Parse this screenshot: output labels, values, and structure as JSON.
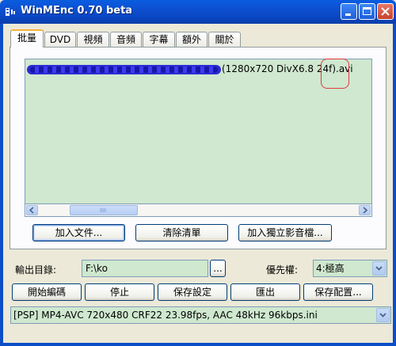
{
  "window": {
    "title": "WinMEnc 0.70 beta"
  },
  "tabs": [
    {
      "label": "批量"
    },
    {
      "label": "DVD"
    },
    {
      "label": "視頻"
    },
    {
      "label": "音頻"
    },
    {
      "label": "字幕"
    },
    {
      "label": "額外"
    },
    {
      "label": "關於"
    }
  ],
  "file_list": {
    "items": [
      {
        "visible_suffix": "(1280x720 DivX6.8 24f).avi"
      }
    ]
  },
  "batch_buttons": {
    "add_file": "加入文件...",
    "clear_list": "清除清單",
    "add_audio": "加入獨立影音檔..."
  },
  "output": {
    "label": "輸出目錄:",
    "value": "F:\\ko",
    "browse_label": "..."
  },
  "priority": {
    "label": "優先權:",
    "selected": "4:極高"
  },
  "actions": {
    "start": "開始編碼",
    "stop": "停止",
    "save_settings": "保存設定",
    "export": "匯出",
    "save_profile": "保存配置..."
  },
  "profile": {
    "selected": "[PSP] MP4-AVC 720x480 CRF22 23.98fps, AAC 48kHz 96kbps.ini"
  },
  "colors": {
    "titlebar": "#0a5de0",
    "field_bg": "#cfe8cf",
    "dialog_bg": "#ece9d8",
    "annotation": "#e0393e"
  },
  "icons": {
    "app": "app-icon",
    "minimize": "minimize-icon",
    "maximize": "maximize-icon",
    "close": "close-icon",
    "scroll_left": "arrow-left-icon",
    "scroll_right": "arrow-right-icon",
    "dropdown": "chevron-down-icon"
  }
}
